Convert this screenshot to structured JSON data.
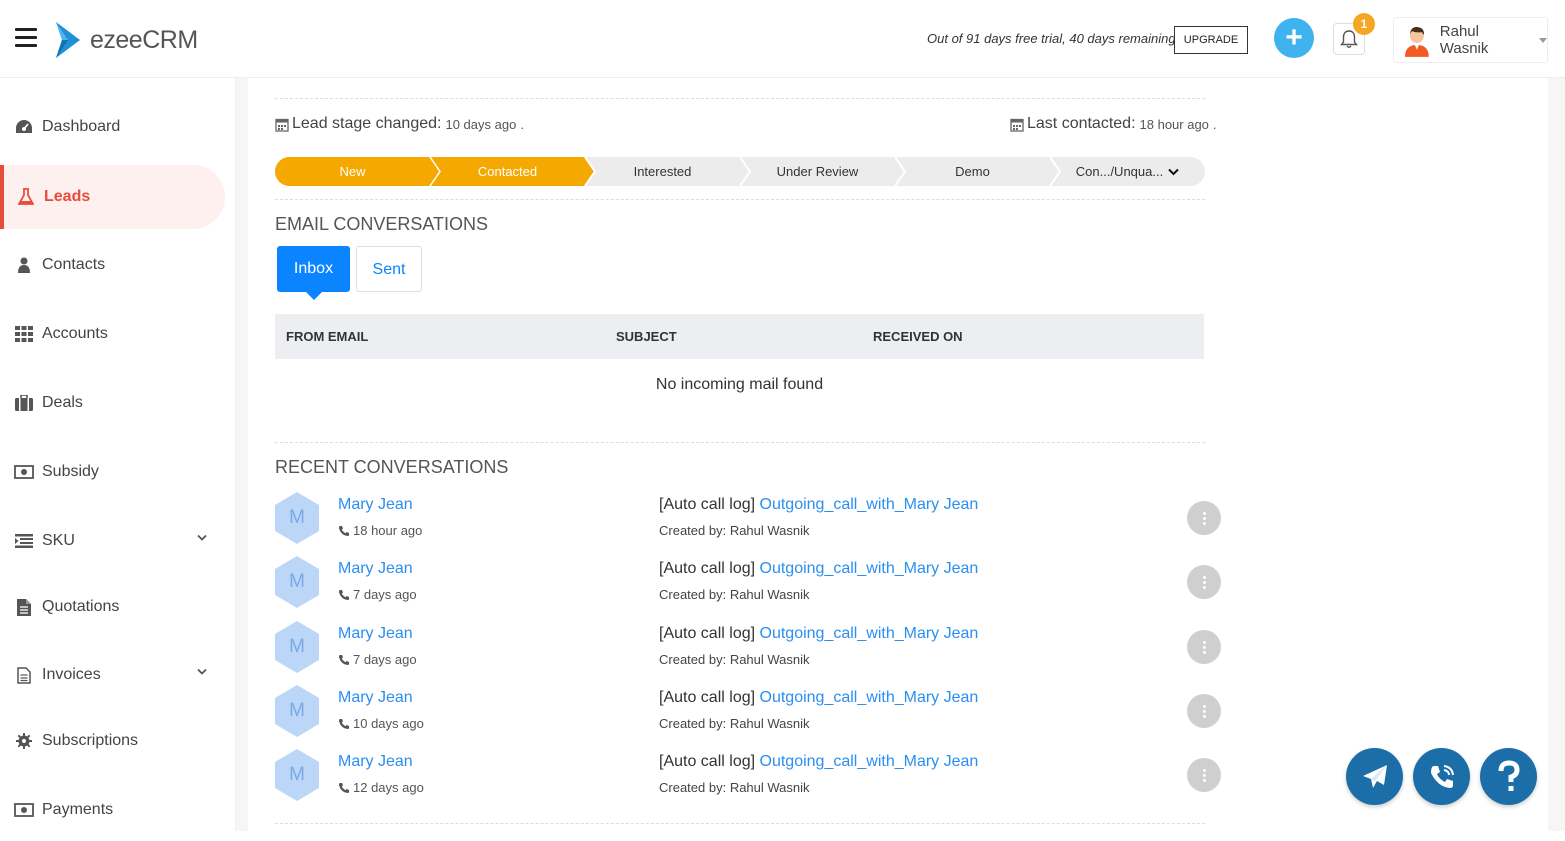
{
  "header": {
    "logo_text": "ezeeCRM",
    "trial_text": "Out of 91 days free trial, 40 days remaining",
    "upgrade_label": "UPGRADE",
    "notification_count": "1",
    "user_name": "Rahul Wasnik"
  },
  "sidebar": {
    "items": [
      {
        "label": "Dashboard",
        "icon": "dashboard-icon"
      },
      {
        "label": "Leads",
        "icon": "flask-icon",
        "active": true
      },
      {
        "label": "Contacts",
        "icon": "user-icon"
      },
      {
        "label": "Accounts",
        "icon": "grid-icon"
      },
      {
        "label": "Deals",
        "icon": "briefcase-icon"
      },
      {
        "label": "Subsidy",
        "icon": "money-icon"
      },
      {
        "label": "SKU",
        "icon": "list-icon",
        "expandable": true
      },
      {
        "label": "Quotations",
        "icon": "file-icon"
      },
      {
        "label": "Invoices",
        "icon": "file-text-icon",
        "expandable": true
      },
      {
        "label": "Subscriptions",
        "icon": "cog-icon"
      },
      {
        "label": "Payments",
        "icon": "money-icon"
      }
    ]
  },
  "lead_meta": {
    "stage_changed_label": "Lead stage changed:",
    "stage_changed_value": "10 days ago",
    "last_contacted_label": "Last contacted:",
    "last_contacted_value": "18 hour ago"
  },
  "stages": [
    {
      "label": "New",
      "done": true
    },
    {
      "label": "Contacted",
      "done": true
    },
    {
      "label": "Interested",
      "done": false
    },
    {
      "label": "Under Review",
      "done": false
    },
    {
      "label": "Demo",
      "done": false
    },
    {
      "label": "Con.../Unqua...",
      "done": false,
      "dropdown": true
    }
  ],
  "colors": {
    "stage_done": "#f5a800",
    "accent_blue": "#0a84ff",
    "link_blue": "#2a8ff0",
    "active_red": "#e74c3c",
    "fab_blue": "#1b6ea8"
  },
  "email": {
    "title": "EMAIL CONVERSATIONS",
    "tabs": {
      "inbox": "Inbox",
      "sent": "Sent"
    },
    "columns": {
      "from": "FROM EMAIL",
      "subject": "SUBJECT",
      "received": "RECEIVED ON"
    },
    "empty_text": "No incoming mail found"
  },
  "recent": {
    "title": "RECENT CONVERSATIONS",
    "items": [
      {
        "initial": "M",
        "name": "Mary Jean",
        "time": "18 hour ago",
        "prefix": "[Auto call log]",
        "link": "Outgoing_call_with_Mary Jean",
        "created_by": "Created by: Rahul Wasnik"
      },
      {
        "initial": "M",
        "name": "Mary Jean",
        "time": "7 days ago",
        "prefix": "[Auto call log]",
        "link": "Outgoing_call_with_Mary Jean",
        "created_by": "Created by: Rahul Wasnik"
      },
      {
        "initial": "M",
        "name": "Mary Jean",
        "time": "7 days ago",
        "prefix": "[Auto call log]",
        "link": "Outgoing_call_with_Mary Jean",
        "created_by": "Created by: Rahul Wasnik"
      },
      {
        "initial": "M",
        "name": "Mary Jean",
        "time": "10 days ago",
        "prefix": "[Auto call log]",
        "link": "Outgoing_call_with_Mary Jean",
        "created_by": "Created by: Rahul Wasnik"
      },
      {
        "initial": "M",
        "name": "Mary Jean",
        "time": "12 days ago",
        "prefix": "[Auto call log]",
        "link": "Outgoing_call_with_Mary Jean",
        "created_by": "Created by: Rahul Wasnik"
      }
    ]
  }
}
